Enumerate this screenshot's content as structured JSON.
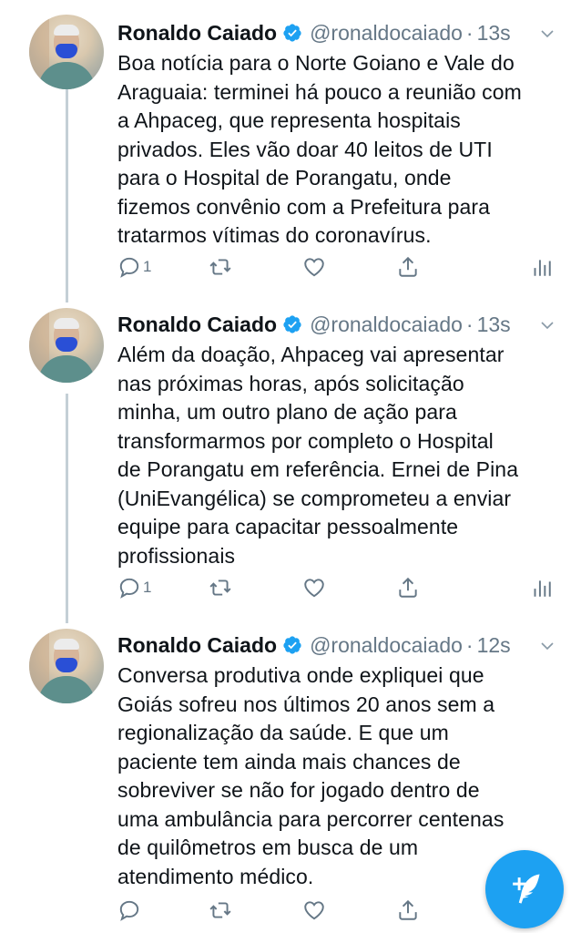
{
  "tweets": [
    {
      "author": "Ronaldo Caiado",
      "handle": "@ronaldocaiado",
      "separator": "·",
      "time": "13s",
      "text": "Boa notícia para o Norte Goiano e Vale do\nAraguaia: terminei há pouco a reunião com\na Ahpaceg, que representa hospitais\nprivados. Eles vão doar 40 leitos de UTI\npara o Hospital de Porangatu, onde\nfizemos convênio com a Prefeitura para\ntratarmos vítimas do coronavírus.",
      "reply_count": "1"
    },
    {
      "author": "Ronaldo Caiado",
      "handle": "@ronaldocaiado",
      "separator": "·",
      "time": "13s",
      "text": "Além da doação, Ahpaceg vai apresentar\nnas próximas horas, após solicitação\nminha, um outro plano de ação para\ntransformarmos por completo o Hospital\nde Porangatu em referência. Ernei de Pina\n(UniEvangélica) se comprometeu a enviar\nequipe para capacitar pessoalmente\nprofissionais",
      "reply_count": "1"
    },
    {
      "author": "Ronaldo Caiado",
      "handle": "@ronaldocaiado",
      "separator": "·",
      "time": "12s",
      "text": "Conversa produtiva onde expliquei que\nGoiás sofreu nos últimos 20 anos sem a\nregionalização da saúde. E que um\npaciente tem ainda mais chances de\nsobreviver se não for jogado dentro de\numa ambulância para percorrer centenas\nde quilômetros em busca de um\natendimento médico.",
      "reply_count": ""
    }
  ],
  "icons": {
    "verified": "verified-badge-icon",
    "chevron": "chevron-down-icon",
    "reply": "reply-icon",
    "retweet": "retweet-icon",
    "like": "heart-icon",
    "share": "share-icon",
    "analytics": "analytics-icon",
    "compose": "compose-tweet-icon"
  },
  "colors": {
    "accent": "#1da1f2",
    "text": "#0f1419",
    "secondary": "#657786",
    "thread_line": "#c4cfd6"
  }
}
